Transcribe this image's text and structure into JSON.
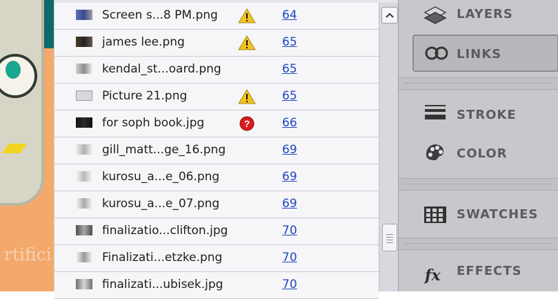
{
  "canvas": {
    "text": "rtifici"
  },
  "links": {
    "rows": [
      {
        "name": "Screen s...8 PM.png",
        "page": "64",
        "status": "warning"
      },
      {
        "name": "james lee.png",
        "page": "65",
        "status": "warning"
      },
      {
        "name": "kendal_st...oard.png",
        "page": "65",
        "status": ""
      },
      {
        "name": "Picture 21.png",
        "page": "65",
        "status": "warning"
      },
      {
        "name": "for soph book.jpg",
        "page": "66",
        "status": "missing"
      },
      {
        "name": "gill_matt...ge_16.png",
        "page": "69",
        "status": ""
      },
      {
        "name": "kurosu_a...e_06.png",
        "page": "69",
        "status": ""
      },
      {
        "name": "kurosu_a...e_07.png",
        "page": "69",
        "status": ""
      },
      {
        "name": "finalizatio...clifton.jpg",
        "page": "70",
        "status": ""
      },
      {
        "name": "Finalizati...etzke.png",
        "page": "70",
        "status": ""
      },
      {
        "name": "finalizati...ubisek.jpg",
        "page": "70",
        "status": ""
      }
    ]
  },
  "panels": [
    {
      "label": "LAYERS",
      "icon": "layers-icon"
    },
    {
      "label": "LINKS",
      "icon": "links-icon"
    },
    {
      "label": "STROKE",
      "icon": "stroke-icon"
    },
    {
      "label": "COLOR",
      "icon": "color-icon"
    },
    {
      "label": "SWATCHES",
      "icon": "swatches-icon"
    },
    {
      "label": "EFFECTS",
      "icon": "effects-icon"
    }
  ],
  "colors": {
    "link": "#1f46c2",
    "warning": "#f2c31f",
    "missing": "#d91b1b"
  }
}
